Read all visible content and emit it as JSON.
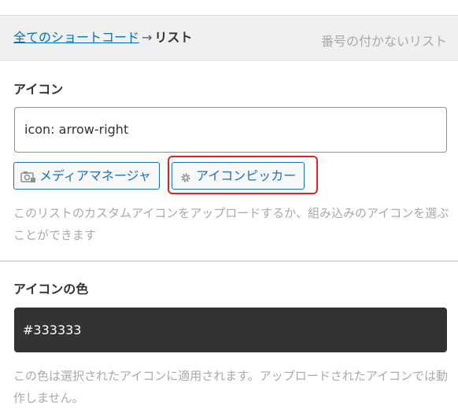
{
  "breadcrumb": {
    "link": "全てのショートコード",
    "arrow": "→",
    "current": "リスト"
  },
  "header_subtitle": "番号の付かないリスト",
  "icon_section": {
    "label": "アイコン",
    "input_value": "icon: arrow-right",
    "media_button": "メディアマネージャ",
    "picker_button": "アイコンピッカー",
    "help_text": "このリストのカスタムアイコンをアップロードするか、組み込みのアイコンを選ぶことができます"
  },
  "color_section": {
    "label": "アイコンの色",
    "value": "#333333",
    "help_text": "この色は選択されたアイコンに適用されます。アップロードされたアイコンでは動作しません。"
  },
  "colors": {
    "link": "#0073aa",
    "button": "#2271b1",
    "highlight": "#e02424",
    "color_swatch": "#333333"
  },
  "icons": {
    "media_button_icon": "camera-icon",
    "picker_button_icon": "gear-icon"
  }
}
